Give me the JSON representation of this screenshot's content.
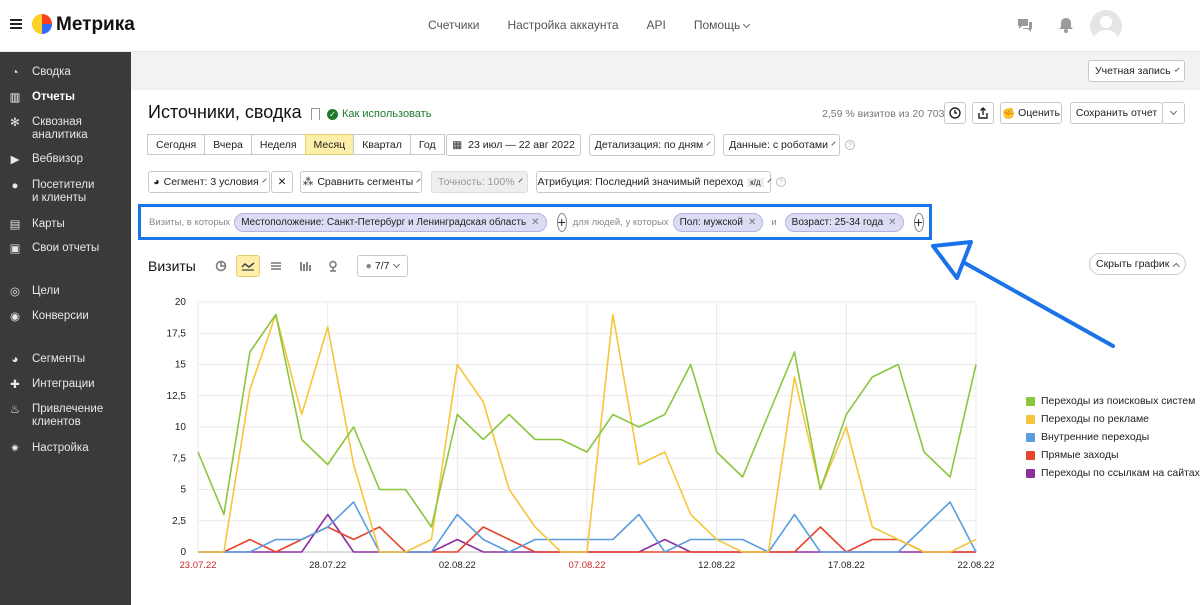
{
  "header": {
    "brand": "Метрика",
    "nav": [
      "Счетчики",
      "Настройка аккаунта",
      "API",
      "Помощь"
    ],
    "icons": [
      "chat-icon",
      "bell-icon"
    ]
  },
  "sidebar": {
    "items": [
      {
        "label": "Сводка",
        "icon": "gauge-icon"
      },
      {
        "label": "Отчеты",
        "icon": "bar-chart-icon",
        "active": true
      },
      {
        "label": "Сквозная\nаналитика",
        "icon": "gear-icon"
      },
      {
        "label": "Вебвизор",
        "icon": "play-icon"
      },
      {
        "label": "Посетители\nи клиенты",
        "icon": "person-icon"
      },
      {
        "label": "Карты",
        "icon": "map-icon"
      },
      {
        "label": "Свои отчеты",
        "icon": "report-icon"
      },
      {
        "label": "Цели",
        "icon": "target-icon"
      },
      {
        "label": "Конверсии",
        "icon": "conversion-icon"
      },
      {
        "label": "Сегменты",
        "icon": "pie-icon"
      },
      {
        "label": "Интеграции",
        "icon": "puzzle-icon"
      },
      {
        "label": "Привлечение\nклиентов",
        "icon": "flame-icon"
      },
      {
        "label": "Настройка",
        "icon": "settings-icon"
      }
    ]
  },
  "account_button": "Учетная запись",
  "page": {
    "title": "Источники, сводка",
    "how_to_use": "Как использовать",
    "stat": "2,59 % визитов из 20 703",
    "rate_button": "Оценить",
    "save_button": "Сохранить отчет"
  },
  "periods": {
    "items": [
      "Сегодня",
      "Вчера",
      "Неделя",
      "Месяц",
      "Квартал",
      "Год"
    ],
    "selected": "Месяц",
    "date_range": "23 июл — 22 авг 2022",
    "detail": "Детализация: по дням",
    "data": "Данные: с роботами"
  },
  "segment_row": {
    "segment": "Сегмент: 3 условия",
    "compare": "Сравнить сегменты",
    "accuracy": "Точность: 100%",
    "attribution": "Атрибуция: Последний значимый переход",
    "attribution_badge": "к/д"
  },
  "filters": {
    "visits_label": "Визиты, в которых",
    "location": "Местоположение: Санкт-Петербург и Ленинградская область",
    "people_label": "для людей, у которых",
    "gender": "Пол: мужской",
    "and_label": "и",
    "age": "Возраст: 25-34 года",
    "close_glyph": "✕",
    "plus_glyph": "+"
  },
  "chart_toolbar": {
    "title": "Визиты",
    "series_count": "7/7",
    "hide_chart": "Скрыть график"
  },
  "chart_data": {
    "type": "line",
    "x": [
      "23.07.22",
      "24.07.22",
      "25.07.22",
      "26.07.22",
      "27.07.22",
      "28.07.22",
      "29.07.22",
      "30.07.22",
      "31.07.22",
      "01.08.22",
      "02.08.22",
      "03.08.22",
      "04.08.22",
      "05.08.22",
      "06.08.22",
      "07.08.22",
      "08.08.22",
      "09.08.22",
      "10.08.22",
      "11.08.22",
      "12.08.22",
      "13.08.22",
      "14.08.22",
      "15.08.22",
      "16.08.22",
      "17.08.22",
      "18.08.22",
      "19.08.22",
      "20.08.22",
      "21.08.22",
      "22.08.22"
    ],
    "xticks": [
      "23.07.22",
      "28.07.22",
      "02.08.22",
      "07.08.22",
      "12.08.22",
      "17.08.22",
      "22.08.22"
    ],
    "xticks_weekend": [
      "23.07.22",
      "07.08.22"
    ],
    "ylim": [
      0,
      20
    ],
    "yticks": [
      "0",
      "2,5",
      "5",
      "7,5",
      "10",
      "12,5",
      "15",
      "17,5",
      "20"
    ],
    "series": [
      {
        "name": "Переходы из поисковых систем",
        "color": "#8cc63f",
        "values": [
          8,
          3,
          16,
          19,
          9,
          7,
          10,
          5,
          5,
          2,
          11,
          9,
          11,
          9,
          9,
          8,
          11,
          10,
          11,
          15,
          8,
          6,
          11,
          16,
          5,
          11,
          14,
          15,
          8,
          6,
          15
        ]
      },
      {
        "name": "Переходы по рекламе",
        "color": "#f5c63c",
        "values": [
          0,
          0,
          13,
          19,
          11,
          18,
          7,
          0,
          0,
          1,
          15,
          12,
          5,
          2,
          0,
          0,
          19,
          7,
          8,
          3,
          1,
          0,
          0,
          14,
          5,
          10,
          2,
          1,
          0,
          0,
          1
        ]
      },
      {
        "name": "Внутренние переходы",
        "color": "#5a9ee0",
        "values": [
          0,
          0,
          0,
          1,
          1,
          2,
          4,
          0,
          0,
          0,
          3,
          1,
          0,
          1,
          1,
          1,
          1,
          3,
          0,
          1,
          1,
          1,
          0,
          3,
          0,
          0,
          0,
          0,
          2,
          4,
          0
        ]
      },
      {
        "name": "Прямые заходы",
        "color": "#e8432c",
        "values": [
          0,
          0,
          1,
          0,
          1,
          2,
          1,
          2,
          0,
          0,
          0,
          2,
          1,
          0,
          0,
          0,
          0,
          0,
          0,
          0,
          0,
          0,
          0,
          0,
          2,
          0,
          1,
          1,
          0,
          0,
          0
        ]
      },
      {
        "name": "Переходы по ссылкам на сайтах",
        "color": "#8b2f9e",
        "values": [
          0,
          0,
          0,
          0,
          0,
          3,
          0,
          0,
          0,
          0,
          1,
          0,
          0,
          0,
          0,
          0,
          0,
          0,
          1,
          0,
          0,
          0,
          0,
          0,
          0,
          0,
          0,
          0,
          0,
          0,
          0
        ]
      }
    ],
    "grid": true,
    "legend": "right"
  }
}
